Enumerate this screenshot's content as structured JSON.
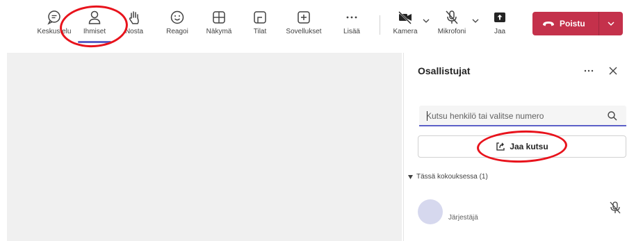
{
  "toolbar": {
    "items": [
      {
        "id": "chat",
        "label": "Keskustelu",
        "icon": "chat-icon"
      },
      {
        "id": "people",
        "label": "Ihmiset",
        "icon": "people-icon",
        "active": true
      },
      {
        "id": "raise",
        "label": "Nosta",
        "icon": "raise-hand-icon"
      },
      {
        "id": "react",
        "label": "Reagoi",
        "icon": "emoji-icon"
      },
      {
        "id": "view",
        "label": "Näkymä",
        "icon": "grid-icon"
      },
      {
        "id": "rooms",
        "label": "Tilat",
        "icon": "rooms-icon"
      },
      {
        "id": "apps",
        "label": "Sovellukset",
        "icon": "add-app-icon"
      },
      {
        "id": "more",
        "label": "Lisää",
        "icon": "more-icon"
      },
      {
        "id": "camera",
        "label": "Kamera",
        "icon": "camera-off-icon"
      },
      {
        "id": "mic",
        "label": "Mikrofoni",
        "icon": "mic-off-icon"
      },
      {
        "id": "share",
        "label": "Jaa",
        "icon": "share-screen-icon"
      }
    ],
    "leave_label": "Poistu"
  },
  "panel": {
    "title": "Osallistujat",
    "search_placeholder": "Kutsu henkilö tai valitse numero",
    "share_invite_label": "Jaa kutsu",
    "section_label": "Tässä kokouksessa (1)",
    "participant_role": "Järjestäjä"
  },
  "colors": {
    "accent": "#5b5fc7",
    "leave": "#c4314b",
    "annotation": "#e8131c",
    "avatar": "#d6d8ee",
    "stage": "#f0f0f0"
  }
}
